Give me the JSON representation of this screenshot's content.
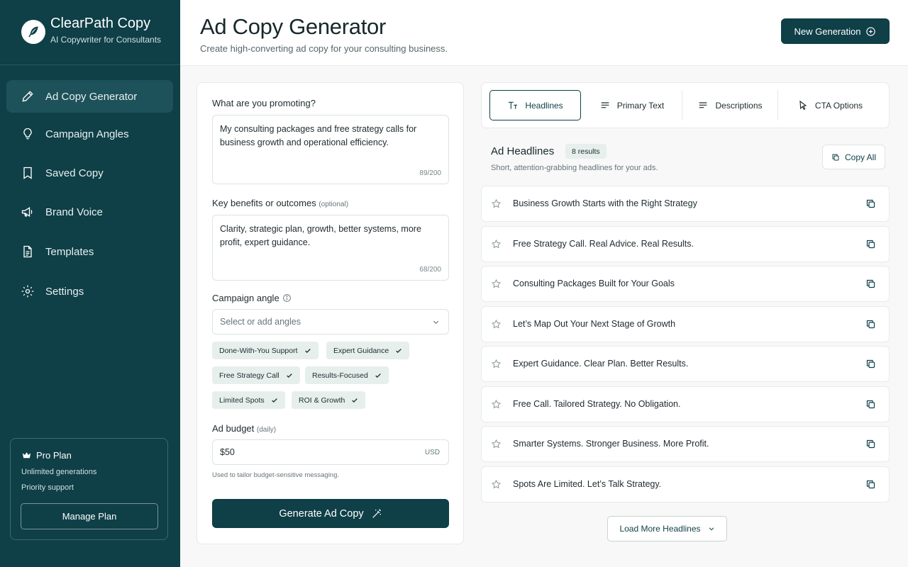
{
  "brand": {
    "name": "ClearPath Copy",
    "tagline": "AI Copywriter for Consultants",
    "logo_icon": "feather-icon"
  },
  "sidebar": {
    "items": [
      {
        "label": "Ad Copy Generator",
        "icon": "pencil-icon",
        "active": true
      },
      {
        "label": "Campaign Angles",
        "icon": "lightbulb-icon",
        "active": false
      },
      {
        "label": "Saved Copy",
        "icon": "bookmark-icon",
        "active": false
      },
      {
        "label": "Brand Voice",
        "icon": "megaphone-icon",
        "active": false
      },
      {
        "label": "Templates",
        "icon": "document-icon",
        "active": false
      },
      {
        "label": "Settings",
        "icon": "gear-icon",
        "active": false
      }
    ],
    "plan": {
      "title": "Pro Plan",
      "features": [
        "Unlimited generations",
        "Priority support"
      ],
      "button": "Manage Plan"
    }
  },
  "header": {
    "title": "Ad Copy Generator",
    "subtitle": "Create high-converting ad copy for your consulting business.",
    "new_button": "New Generation"
  },
  "form": {
    "promoting_label": "What are you promoting?",
    "promoting_value": "My consulting packages and free strategy calls for business growth and operational efficiency.",
    "promoting_count": "89/200",
    "benefits_label": "Key benefits or outcomes",
    "benefits_optional": "(optional)",
    "benefits_value": "Clarity, strategic plan, growth, better systems, more profit, expert guidance.",
    "benefits_count": "68/200",
    "angle_label": "Campaign angle",
    "angle_placeholder": "Select or add angles",
    "angles": [
      "Done-With-You Support",
      "Expert Guidance",
      "Free Strategy Call",
      "Results-Focused",
      "Limited Spots",
      "ROI & Growth"
    ],
    "budget_label": "Ad budget",
    "budget_qualifier": "(daily)",
    "budget_value": "$50",
    "budget_unit": "USD",
    "budget_hint": "Used to tailor budget-sensitive messaging.",
    "generate_button": "Generate Ad Copy"
  },
  "tabs": [
    {
      "label": "Headlines",
      "icon": "text-icon",
      "active": true
    },
    {
      "label": "Primary Text",
      "icon": "lines-icon",
      "active": false
    },
    {
      "label": "Descriptions",
      "icon": "lines-icon",
      "active": false
    },
    {
      "label": "CTA Options",
      "icon": "cursor-icon",
      "active": false
    }
  ],
  "results": {
    "title": "Ad Headlines",
    "badge": "8 results",
    "subtitle": "Short, attention-grabbing headlines for your ads.",
    "copy_all": "Copy All",
    "items": [
      "Business Growth Starts with the Right Strategy",
      "Free Strategy Call. Real Advice. Real Results.",
      "Consulting Packages Built for Your Goals",
      "Let’s Map Out Your Next Stage of Growth",
      "Expert Guidance. Clear Plan. Better Results.",
      "Free Call. Tailored Strategy. No Obligation.",
      "Smarter Systems. Stronger Business. More Profit.",
      "Spots Are Limited. Let’s Talk Strategy."
    ],
    "load_more": "Load More Headlines"
  },
  "colors": {
    "brand": "#0f3f47",
    "sidebar_active": "#1e525a",
    "chip_bg": "#e7efed"
  }
}
